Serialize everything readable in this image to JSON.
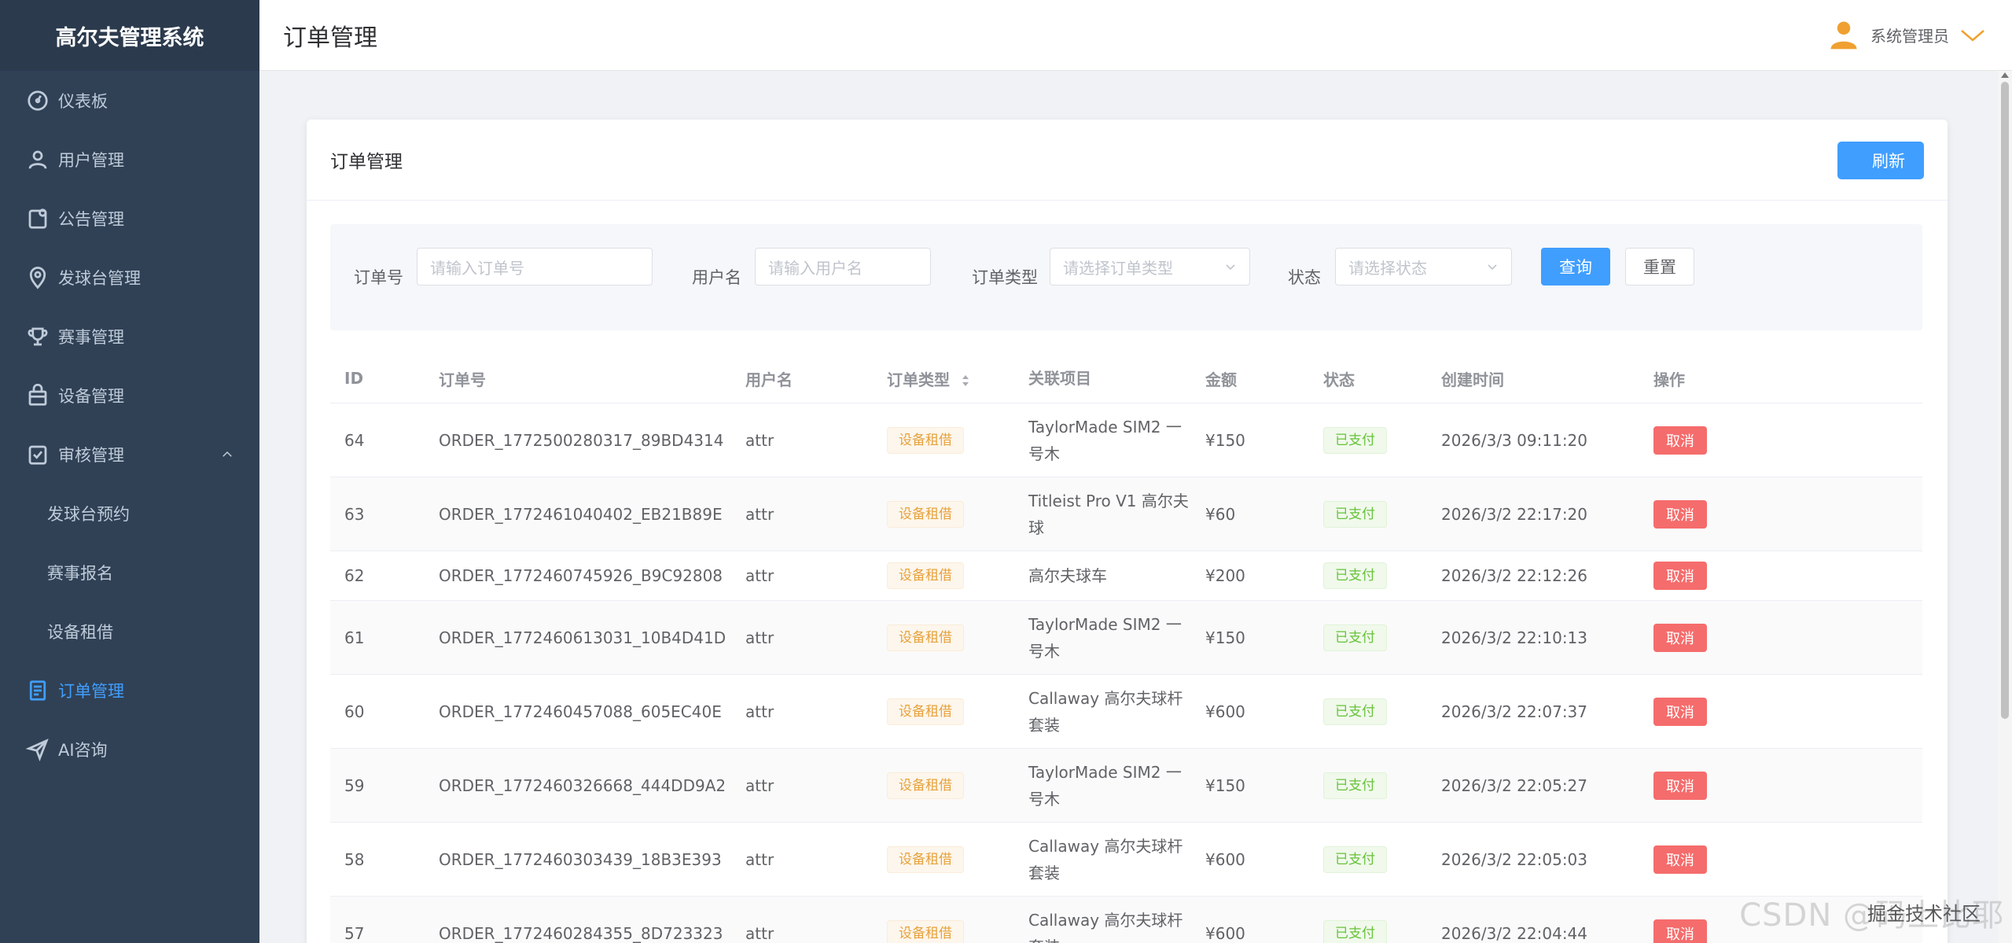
{
  "app": {
    "title": "高尔夫管理系统"
  },
  "sidebar": {
    "items": [
      {
        "label": "仪表板",
        "icon": "dashboard-icon"
      },
      {
        "label": "用户管理",
        "icon": "user-icon"
      },
      {
        "label": "公告管理",
        "icon": "notice-icon"
      },
      {
        "label": "发球台管理",
        "icon": "location-icon"
      },
      {
        "label": "赛事管理",
        "icon": "trophy-icon"
      },
      {
        "label": "设备管理",
        "icon": "bag-icon"
      },
      {
        "label": "审核管理",
        "icon": "audit-icon",
        "expanded": true,
        "children": [
          {
            "label": "发球台预约"
          },
          {
            "label": "赛事报名"
          },
          {
            "label": "设备租借"
          }
        ]
      },
      {
        "label": "订单管理",
        "icon": "order-icon",
        "active": true
      },
      {
        "label": "AI咨询",
        "icon": "send-icon"
      }
    ],
    "active_color": "#409eff"
  },
  "header": {
    "title": "订单管理",
    "user": "系统管理员"
  },
  "card": {
    "title": "订单管理",
    "refresh_label": "刷新"
  },
  "search": {
    "order_no_label": "订单号",
    "order_no_placeholder": "请输入订单号",
    "username_label": "用户名",
    "username_placeholder": "请输入用户名",
    "type_label": "订单类型",
    "type_placeholder": "请选择订单类型",
    "status_label": "状态",
    "status_placeholder": "请选择状态",
    "query_label": "查询",
    "reset_label": "重置"
  },
  "table": {
    "columns": [
      "ID",
      "订单号",
      "用户名",
      "订单类型",
      "关联项目",
      "金额",
      "状态",
      "创建时间",
      "操作"
    ],
    "rows": [
      {
        "id": "64",
        "order_no": "ORDER_1772500280317_89BD4314",
        "user": "attr",
        "type": "设备租借",
        "project": "TaylorMade SIM2 一号木",
        "amount": "¥150",
        "status": "已支付",
        "time": "2026/3/3 09:11:20",
        "op": "取消"
      },
      {
        "id": "63",
        "order_no": "ORDER_1772461040402_EB21B89E",
        "user": "attr",
        "type": "设备租借",
        "project": "Titleist Pro V1 高尔夫球",
        "amount": "¥60",
        "status": "已支付",
        "time": "2026/3/2 22:17:20",
        "op": "取消"
      },
      {
        "id": "62",
        "order_no": "ORDER_1772460745926_B9C92808",
        "user": "attr",
        "type": "设备租借",
        "project": "高尔夫球车",
        "amount": "¥200",
        "status": "已支付",
        "time": "2026/3/2 22:12:26",
        "op": "取消"
      },
      {
        "id": "61",
        "order_no": "ORDER_1772460613031_10B4D41D",
        "user": "attr",
        "type": "设备租借",
        "project": "TaylorMade SIM2 一号木",
        "amount": "¥150",
        "status": "已支付",
        "time": "2026/3/2 22:10:13",
        "op": "取消"
      },
      {
        "id": "60",
        "order_no": "ORDER_1772460457088_605EC40E",
        "user": "attr",
        "type": "设备租借",
        "project": "Callaway 高尔夫球杆套装",
        "amount": "¥600",
        "status": "已支付",
        "time": "2026/3/2 22:07:37",
        "op": "取消"
      },
      {
        "id": "59",
        "order_no": "ORDER_1772460326668_444DD9A2",
        "user": "attr",
        "type": "设备租借",
        "project": "TaylorMade SIM2 一号木",
        "amount": "¥150",
        "status": "已支付",
        "time": "2026/3/2 22:05:27",
        "op": "取消"
      },
      {
        "id": "58",
        "order_no": "ORDER_1772460303439_18B3E393",
        "user": "attr",
        "type": "设备租借",
        "project": "Callaway 高尔夫球杆套装",
        "amount": "¥600",
        "status": "已支付",
        "time": "2026/3/2 22:05:03",
        "op": "取消"
      },
      {
        "id": "57",
        "order_no": "ORDER_1772460284355_8D723323",
        "user": "attr",
        "type": "设备租借",
        "project": "Callaway 高尔夫球杆套装",
        "amount": "¥600",
        "status": "已支付",
        "time": "2026/3/2 22:04:44",
        "op": "取消"
      }
    ]
  },
  "watermark": "CSDN @码上比耶",
  "watermark2": "掘金技术社区"
}
